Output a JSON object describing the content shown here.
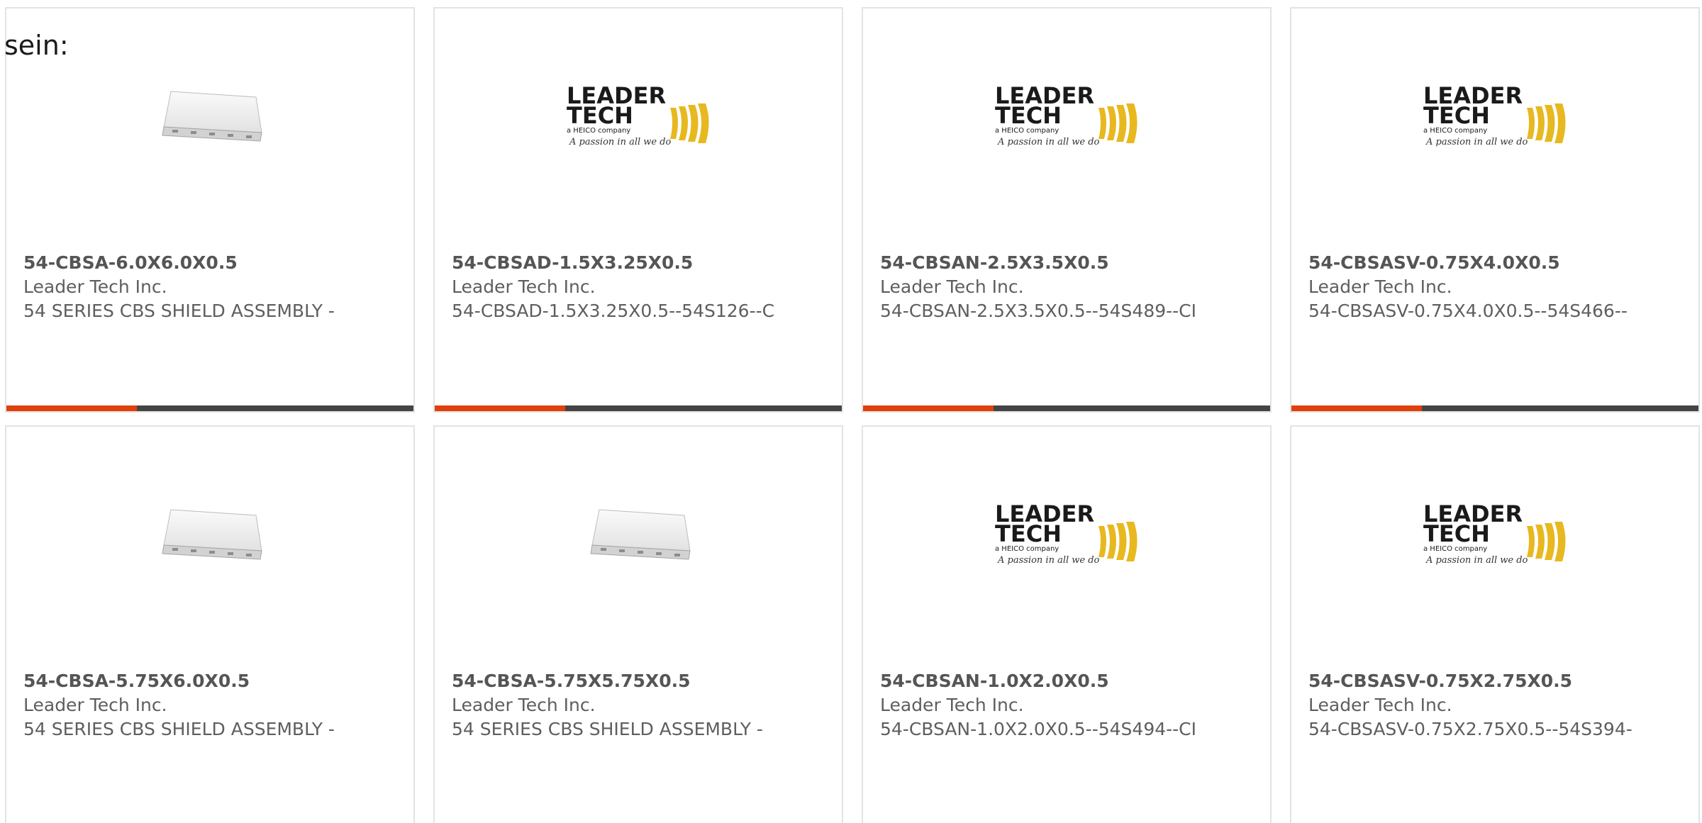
{
  "heading": "sein:",
  "colors": {
    "border": "#e3e3e3",
    "bar_dark": "#444444",
    "bar_accent": "#e0400b",
    "logo_gold": "#e8b820"
  },
  "logo": {
    "line1": "LEADER",
    "line2": "TECH",
    "line3": "a HEICO company",
    "tagline": "A passion in all we do"
  },
  "products": [
    {
      "part_no": "54-CBSA-6.0X6.0X0.5",
      "manufacturer": "Leader Tech Inc.",
      "description": "54 SERIES CBS SHIELD ASSEMBLY -",
      "image": "shield-product-photo"
    },
    {
      "part_no": "54-CBSAD-1.5X3.25X0.5",
      "manufacturer": "Leader Tech Inc.",
      "description": "54-CBSAD-1.5X3.25X0.5--54S126--C",
      "image": "leader-tech-logo"
    },
    {
      "part_no": "54-CBSAN-2.5X3.5X0.5",
      "manufacturer": "Leader Tech Inc.",
      "description": "54-CBSAN-2.5X3.5X0.5--54S489--CI",
      "image": "leader-tech-logo"
    },
    {
      "part_no": "54-CBSASV-0.75X4.0X0.5",
      "manufacturer": "Leader Tech Inc.",
      "description": "54-CBSASV-0.75X4.0X0.5--54S466--",
      "image": "leader-tech-logo"
    },
    {
      "part_no": "54-CBSA-5.75X6.0X0.5",
      "manufacturer": "Leader Tech Inc.",
      "description": "54 SERIES CBS SHIELD ASSEMBLY -",
      "image": "shield-product-photo"
    },
    {
      "part_no": "54-CBSA-5.75X5.75X0.5",
      "manufacturer": "Leader Tech Inc.",
      "description": "54 SERIES CBS SHIELD ASSEMBLY -",
      "image": "shield-product-photo"
    },
    {
      "part_no": "54-CBSAN-1.0X2.0X0.5",
      "manufacturer": "Leader Tech Inc.",
      "description": "54-CBSAN-1.0X2.0X0.5--54S494--CI",
      "image": "leader-tech-logo"
    },
    {
      "part_no": "54-CBSASV-0.75X2.75X0.5",
      "manufacturer": "Leader Tech Inc.",
      "description": "54-CBSASV-0.75X2.75X0.5--54S394-",
      "image": "leader-tech-logo"
    }
  ]
}
